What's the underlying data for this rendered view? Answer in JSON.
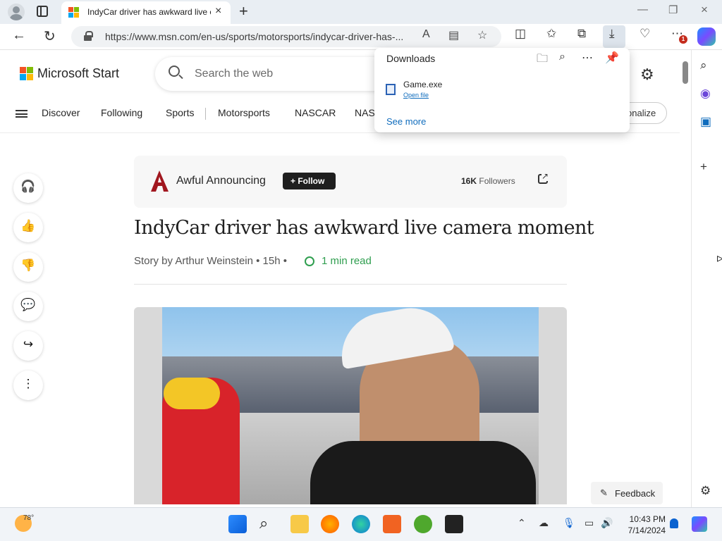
{
  "browser": {
    "tab_title": "IndyCar driver has awkward live camera moment",
    "new_tab_symbol": "+",
    "url": "https://www.msn.com/en-us/sports/motorsports/indycar-driver-has-...",
    "read_aloud_text": "A",
    "notification_badge": "1"
  },
  "downloads": {
    "title": "Downloads",
    "file_name": "Game.exe",
    "open_file_label": "Open file",
    "see_more_label": "See more"
  },
  "page": {
    "brand": "Microsoft Start",
    "search_placeholder": "Search the web",
    "nav_items": [
      "Discover",
      "Following",
      "Sports",
      "Motorsports",
      "NASCAR",
      "NAS"
    ],
    "personalize_label": "onalize",
    "publisher": "Awful Announcing",
    "follow_label": "+ Follow",
    "followers_count": "16K",
    "followers_label": "Followers",
    "headline": "IndyCar driver has awkward live camera moment",
    "byline": "Story by Arthur Weinstein • 15h •",
    "read_time": "1 min read",
    "feedback_label": "Feedback"
  },
  "taskbar": {
    "temperature": "78°",
    "time": "10:43 PM",
    "date": "7/14/2024"
  },
  "icons": {
    "favorite_color": "#2f9e4f",
    "badge_color": "#c42b1c",
    "accent_link": "#0f6cbd"
  }
}
